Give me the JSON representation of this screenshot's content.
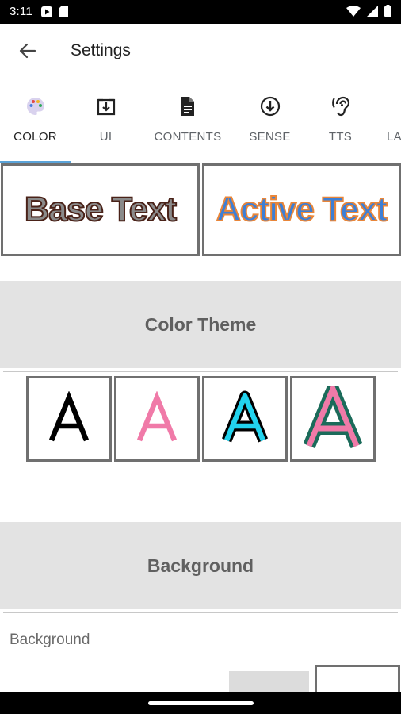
{
  "status_bar": {
    "time": "3:11"
  },
  "app_bar": {
    "title": "Settings"
  },
  "tabs": [
    {
      "label": "COLOR",
      "icon": "palette-icon",
      "active": true
    },
    {
      "label": "UI",
      "icon": "download-box-icon"
    },
    {
      "label": "CONTENTS",
      "icon": "document-icon"
    },
    {
      "label": "SENSE",
      "icon": "arrow-circle-down-icon"
    },
    {
      "label": "TTS",
      "icon": "hearing-icon"
    },
    {
      "label": "LA",
      "icon": ""
    }
  ],
  "preview": {
    "base_text": "Base Text",
    "active_text": "Active Text"
  },
  "color_theme": {
    "title": "Color Theme",
    "options": [
      {
        "letter": "A",
        "fill": "#000000",
        "stroke": "none"
      },
      {
        "letter": "A",
        "fill": "#f07aa8",
        "stroke": "none"
      },
      {
        "letter": "A",
        "fill": "#22d3ee",
        "stroke": "#000000"
      },
      {
        "letter": "A",
        "fill": "#f07aa8",
        "stroke": "#1b6b5a"
      }
    ]
  },
  "background_section": {
    "title": "Background",
    "label": "Background"
  }
}
